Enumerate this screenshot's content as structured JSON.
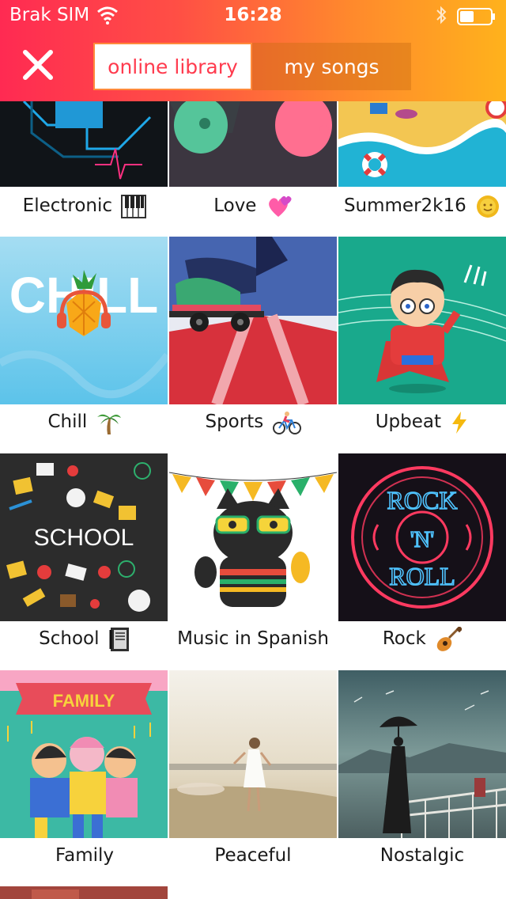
{
  "status_bar": {
    "carrier": "Brak SIM",
    "time": "16:28"
  },
  "header": {
    "tabs": [
      {
        "label": "online library",
        "active": true
      },
      {
        "label": "my songs",
        "active": false
      }
    ],
    "close_icon": "close-icon"
  },
  "colors": {
    "header_start": "#ff2a52",
    "header_end": "#ffb21c",
    "active_tab_text": "#ff3b4e"
  },
  "categories": [
    {
      "title": "Electronic",
      "icon": "piano-icon"
    },
    {
      "title": "Love",
      "icon": "hearts-icon"
    },
    {
      "title": "Summer2k16",
      "icon": "sun-icon"
    },
    {
      "title": "Chill",
      "icon": "palm-tree-icon"
    },
    {
      "title": "Sports",
      "icon": "bicycle-icon"
    },
    {
      "title": "Upbeat",
      "icon": "lightning-icon"
    },
    {
      "title": "School",
      "icon": "notebook-icon"
    },
    {
      "title": "Music in Spanish",
      "icon": ""
    },
    {
      "title": "Rock",
      "icon": "guitar-icon"
    },
    {
      "title": "Family",
      "icon": ""
    },
    {
      "title": "Peaceful",
      "icon": ""
    },
    {
      "title": "Nostalgic",
      "icon": ""
    }
  ],
  "artwork_text": {
    "chill": "CHILL",
    "school": "SCHOOL",
    "family": "FAMILY",
    "rock_top": "ROCK",
    "rock_mid": "'N'",
    "rock_bottom": "ROLL"
  }
}
